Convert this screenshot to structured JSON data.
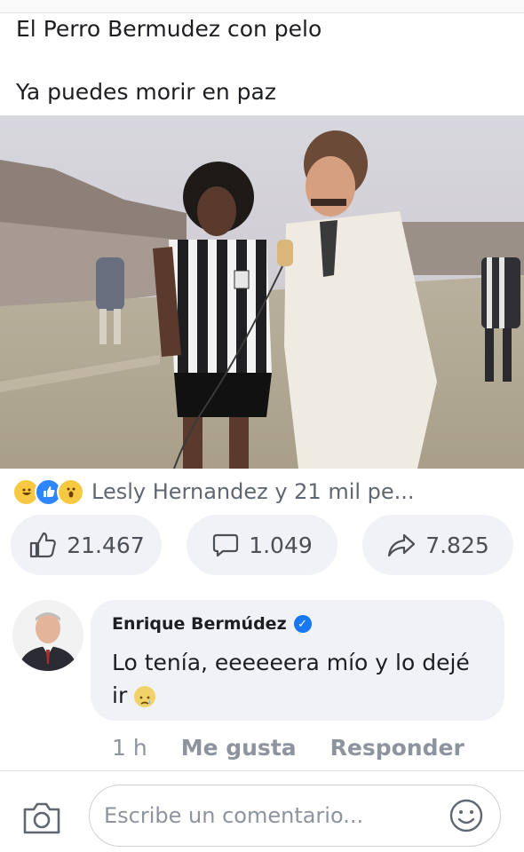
{
  "post": {
    "line1": "El Perro Bermudez con pelo",
    "line2": "Ya puedes morir en paz"
  },
  "reactions": {
    "icons": [
      "laugh-emoji",
      "like-thumb",
      "wow-emoji"
    ],
    "summary": "Lesly Hernandez y 21 mil pe..."
  },
  "actions": {
    "likes": "21.467",
    "comments": "1.049",
    "shares": "7.825"
  },
  "comment": {
    "author": "Enrique Bermúdez",
    "text": "Lo tenía, eeeeeera mío y lo dejé ir",
    "emoji": "sad-emoji",
    "time": "1 h",
    "like_label": "Me gusta",
    "reply_label": "Responder"
  },
  "composer": {
    "placeholder": "Escribe un comentario..."
  },
  "colors": {
    "accent": "#1877f2",
    "pill_bg": "#f0f2f5",
    "muted_text": "#8d949e"
  }
}
